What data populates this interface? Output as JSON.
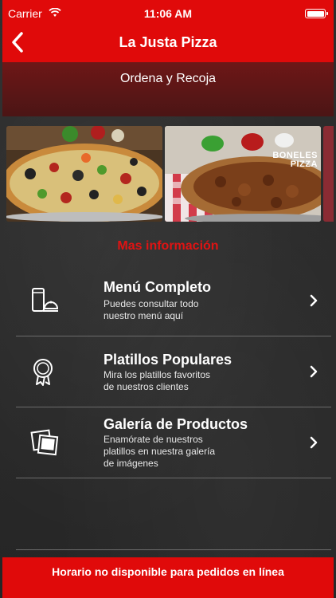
{
  "status_bar": {
    "carrier": "Carrier",
    "time": "11:06 AM"
  },
  "nav": {
    "title": "La Justa Pizza"
  },
  "header": {
    "subtitle": "Ordena y Recoja"
  },
  "carousel": {
    "overlay_title_line1": "BONELES",
    "overlay_title_line2": "PIZZA"
  },
  "section": {
    "title": "Mas información"
  },
  "menu": [
    {
      "title": "Menú Completo",
      "description_lines": [
        "Puedes consultar todo",
        "nuestro menú aquí"
      ],
      "icon": "menu-phone-icon"
    },
    {
      "title": "Platillos Populares",
      "description_lines": [
        "Mira los platillos favoritos",
        "de nuestros clientes"
      ],
      "icon": "award-ribbon-icon"
    },
    {
      "title": "Galería de Productos",
      "description_lines": [
        "Enamórate de nuestros",
        "platillos en nuestra galería",
        "de imágenes"
      ],
      "icon": "photo-gallery-icon"
    }
  ],
  "bottom_bar": {
    "message": "Horario no disponible para pedidos en línea"
  },
  "colors": {
    "brand_red": "#e00a0a",
    "section_title_red": "#e01313",
    "background": "#2a2a2a"
  }
}
